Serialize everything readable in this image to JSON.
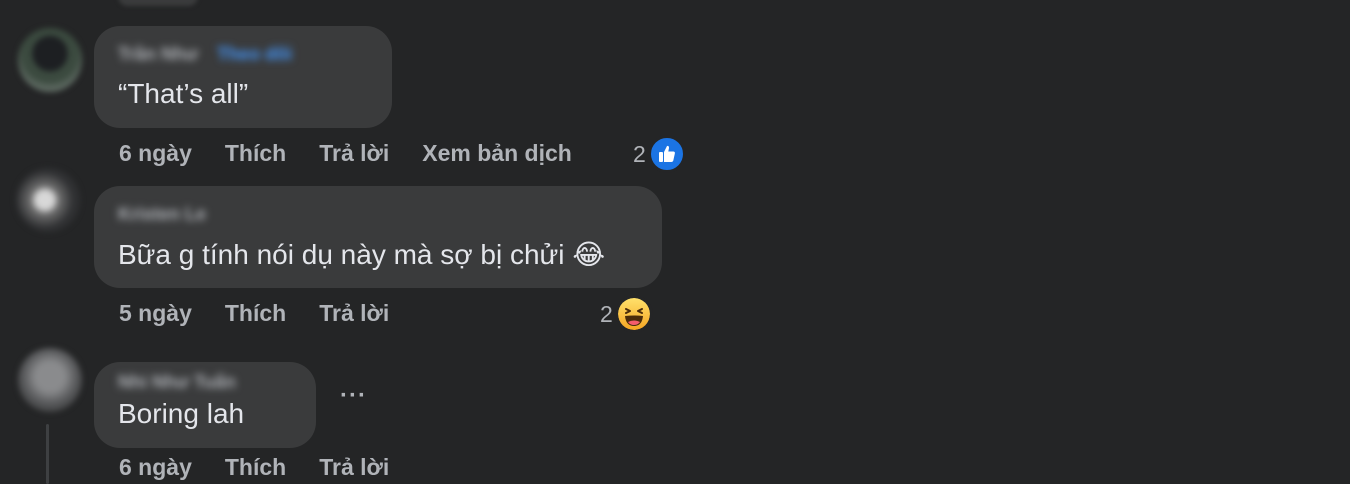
{
  "comments": [
    {
      "author": "Trần Như",
      "follow": "Theo dõi",
      "text": "“That’s all”",
      "time": "6 ngày",
      "like": "Thích",
      "reply": "Trả lời",
      "translate": "Xem bản dịch",
      "reaction_count": "2",
      "reaction_icon": "like-icon"
    },
    {
      "author": "Kristen Le",
      "text": "Bữa g tính nói dụ này mà sợ bị chửi",
      "text_emoji": "😂",
      "time": "5 ngày",
      "like": "Thích",
      "reply": "Trả lời",
      "reaction_count": "2",
      "reaction_icon": "haha-icon"
    },
    {
      "author": "Nhi Như Tuấn",
      "text": "Boring lah",
      "time": "6 ngày",
      "like": "Thích",
      "reply": "Trả lời",
      "more": "···"
    }
  ],
  "colors": {
    "background": "#242526",
    "bubble": "#3a3b3c",
    "text": "#e4e6eb",
    "muted": "#b0b3b8",
    "like_blue": "#1b74e4",
    "follow_blue": "#4599ff"
  }
}
